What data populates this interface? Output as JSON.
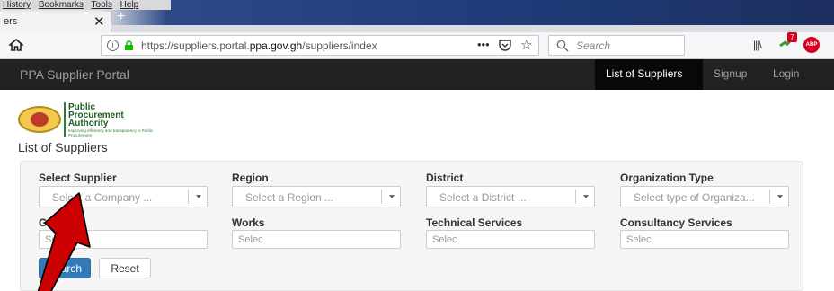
{
  "browser": {
    "menu": [
      "History",
      "Bookmarks",
      "Tools",
      "Help"
    ],
    "tab_title": "ers",
    "url_prefix": "https://suppliers.portal.",
    "url_domain": "ppa.gov.gh",
    "url_path": "/suppliers/index",
    "url_dots": "•••",
    "search_placeholder": "Search",
    "addon_badge": "7",
    "abp_label": "ABP"
  },
  "site": {
    "brand": "PPA Supplier Portal",
    "nav": {
      "list_of_suppliers": "List of Suppliers",
      "signup": "Signup",
      "login": "Login"
    }
  },
  "logo": {
    "line1": "Public",
    "line2": "Procurement",
    "line3": "Authority",
    "tagline": "Improving efficiency and transparency in Public Procurement"
  },
  "page": {
    "title": "List of Suppliers"
  },
  "filters": {
    "select_supplier": {
      "label": "Select Supplier",
      "placeholder": "Select a Company ..."
    },
    "region": {
      "label": "Region",
      "placeholder": "Select a Region ..."
    },
    "district": {
      "label": "District",
      "placeholder": "Select a District ..."
    },
    "organization_type": {
      "label": "Organization Type",
      "placeholder": "Select type of Organiza..."
    },
    "goods": {
      "label": "Goods",
      "placeholder": "Selec"
    },
    "works": {
      "label": "Works",
      "placeholder": "Selec"
    },
    "technical_services": {
      "label": "Technical Services",
      "placeholder": "Selec"
    },
    "consultancy_services": {
      "label": "Consultancy Services",
      "placeholder": "Selec"
    }
  },
  "buttons": {
    "search": "Search",
    "reset": "Reset"
  },
  "colors": {
    "navbar_bg": "#222222",
    "primary": "#337ab7",
    "annotation_arrow": "#cc0000"
  }
}
